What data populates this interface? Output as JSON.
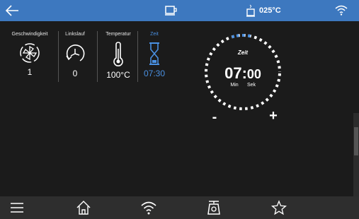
{
  "topbar": {
    "back_icon": "back-arrow-icon",
    "center_icon": "cup-icon",
    "temperature": "025°C",
    "wifi_icon": "wifi-icon"
  },
  "params": [
    {
      "label": "Geschwindigkeit",
      "value": "1",
      "icon": "fan-speed-icon"
    },
    {
      "label": "Linkslauf",
      "value": "0",
      "icon": "reverse-rotation-icon"
    },
    {
      "label": "Temperatur",
      "value": "100°C",
      "icon": "thermometer-icon"
    },
    {
      "label": "Zeit",
      "value": "07:30",
      "icon": "hourglass-icon"
    }
  ],
  "dial": {
    "label": "Zeit",
    "minutes": "07",
    "separator": ":",
    "seconds": "00",
    "min_unit": "Min",
    "sec_unit": "Sek",
    "minus": "-",
    "plus": "+"
  },
  "bottombar": {
    "icons": [
      "menu-icon",
      "home-icon",
      "wifi-icon",
      "scale-icon",
      "star-icon"
    ]
  },
  "colors": {
    "accent": "#3d78bf",
    "active_blue": "#4a90e2",
    "background": "#1b1b1b",
    "bottombar": "#2e2e2e"
  }
}
